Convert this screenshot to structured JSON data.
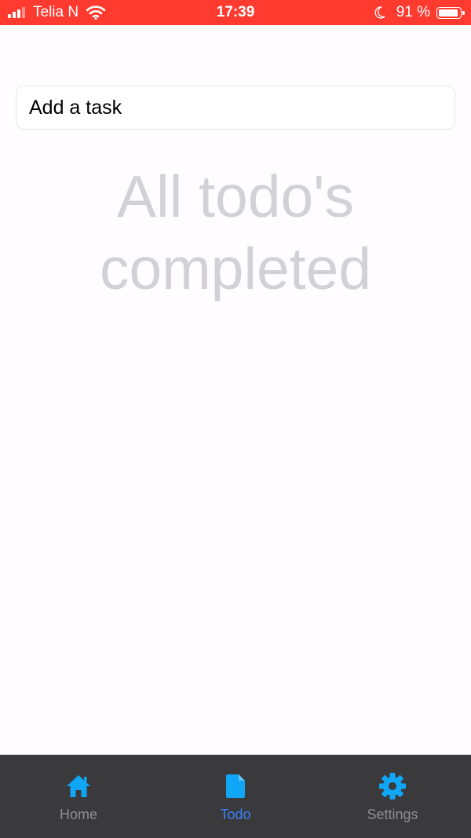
{
  "status_bar": {
    "carrier": "Telia N",
    "time": "17:39",
    "battery_percent": "91 %",
    "battery_level": 0.91,
    "background": "#ff3b30",
    "icons": [
      "signal-icon",
      "wifi-icon",
      "moon-icon",
      "battery-icon"
    ]
  },
  "task_input": {
    "placeholder": "Add a task",
    "value": ""
  },
  "empty_state": {
    "message": "All todo's completed"
  },
  "tab_bar": {
    "background": "#3a393c",
    "icon_color": "#10a5f5",
    "active_label_color": "#3b82f6",
    "inactive_label_color": "#8e8e93",
    "tabs": [
      {
        "label": "Home",
        "icon": "home-icon",
        "active": false
      },
      {
        "label": "Todo",
        "icon": "document-icon",
        "active": true
      },
      {
        "label": "Settings",
        "icon": "gear-icon",
        "active": false
      }
    ]
  }
}
